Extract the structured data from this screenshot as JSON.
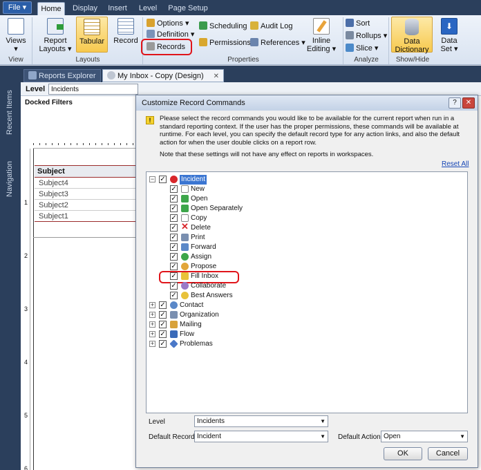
{
  "ribbon": {
    "file_label": "File ▾",
    "tabs": [
      "Home",
      "Display",
      "Insert",
      "Level",
      "Page Setup"
    ],
    "views": {
      "label": "Views ▾",
      "group": "View"
    },
    "layouts": {
      "report_layouts": "Report Layouts ▾",
      "tabular": "Tabular",
      "record": "Record",
      "group": "Layouts"
    },
    "properties": {
      "options": "Options ▾",
      "definition": "Definition ▾",
      "records": "Records",
      "scheduling": "Scheduling",
      "audit_log": "Audit Log",
      "permissions": "Permissions",
      "references": "References ▾",
      "inline_editing": "Inline Editing ▾",
      "group": "Properties"
    },
    "analyze": {
      "sort": "Sort",
      "rollups": "Rollups ▾",
      "slice": "Slice ▾",
      "group": "Analyze"
    },
    "show_hide": {
      "data_dictionary": "Data Dictionary",
      "data_set": "Data Set ▾",
      "group": "Show/Hide"
    }
  },
  "sidebar": {
    "recent_items": "Recent Items",
    "navigation": "Navigation"
  },
  "doc_tabs": [
    {
      "label": "Reports Explorer"
    },
    {
      "label": "My Inbox - Copy (Design)"
    }
  ],
  "report": {
    "level_label": "Level",
    "level_value": "Incidents",
    "docked_filters": "Docked Filters",
    "column_header": "Subject",
    "rows": [
      "Subject4",
      "Subject3",
      "Subject2",
      "Subject1"
    ],
    "ruler_numbers": [
      "1",
      "2",
      "3",
      "4",
      "5",
      "6"
    ]
  },
  "dialog": {
    "title": "Customize Record Commands",
    "info_text": "Please select the record commands you would like to be available for the current report when run in a standard reporting context. If the user has the proper permissions, these commands will be available at runtime. For each level, you can specify the default record type for any action links, and also the default action for when the user double clicks on a report row.",
    "note_text": "Note that these settings will not have any effect on reports in workspaces.",
    "reset_all": "Reset All",
    "tree": {
      "root": "Incident",
      "children": [
        "New",
        "Open",
        "Open Separately",
        "Copy",
        "Delete",
        "Print",
        "Forward",
        "Assign",
        "Propose",
        "Fill Inbox",
        "Collaborate",
        "Best Answers"
      ],
      "others": [
        "Contact",
        "Organization",
        "Mailing",
        "Flow",
        "Problemas"
      ]
    },
    "level_label": "Level",
    "level_value": "Incidents",
    "default_record_label": "Default Record",
    "default_record_value": "Incident",
    "default_action_label": "Default Action",
    "default_action_value": "Open",
    "ok": "OK",
    "cancel": "Cancel"
  },
  "colors": {
    "accent": "#2b3f5c",
    "highlight": "#e0141a"
  }
}
